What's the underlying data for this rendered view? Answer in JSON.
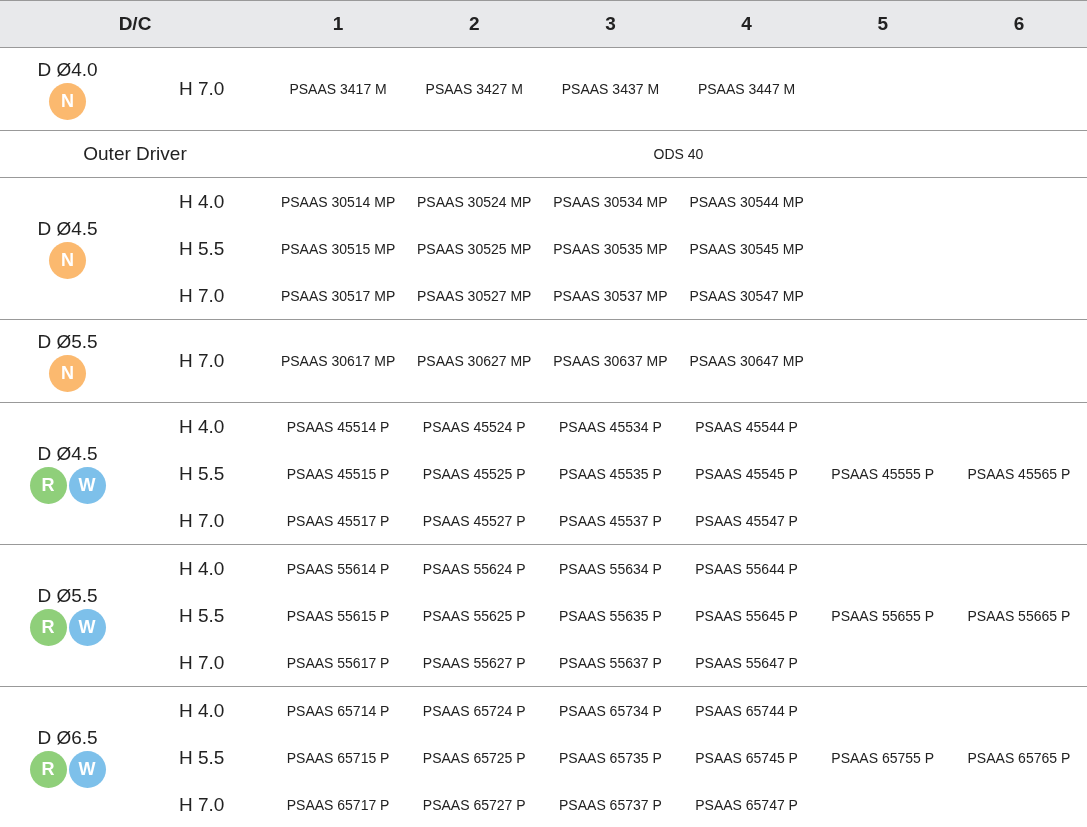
{
  "header": {
    "label": "D/C",
    "columns": [
      "1",
      "2",
      "3",
      "4",
      "5",
      "6"
    ]
  },
  "sections": [
    {
      "kind": "group",
      "diameter": "D Ø4.0",
      "badges": [
        {
          "letter": "N",
          "color": "#fbb96f"
        }
      ],
      "rows": [
        {
          "height": "H 7.0",
          "codes": [
            "PSAAS 3417 M",
            "PSAAS 3427 M",
            "PSAAS 3437 M",
            "PSAAS 3447 M"
          ]
        }
      ]
    },
    {
      "kind": "span",
      "label": "Outer Driver",
      "value": "ODS 40"
    },
    {
      "kind": "group",
      "diameter": "D Ø4.5",
      "badges": [
        {
          "letter": "N",
          "color": "#fbb96f"
        }
      ],
      "rows": [
        {
          "height": "H 4.0",
          "codes": [
            "PSAAS 30514 MP",
            "PSAAS 30524 MP",
            "PSAAS 30534 MP",
            "PSAAS 30544 MP"
          ]
        },
        {
          "height": "H 5.5",
          "codes": [
            "PSAAS 30515 MP",
            "PSAAS 30525 MP",
            "PSAAS 30535 MP",
            "PSAAS 30545 MP"
          ]
        },
        {
          "height": "H 7.0",
          "codes": [
            "PSAAS 30517 MP",
            "PSAAS 30527 MP",
            "PSAAS 30537 MP",
            "PSAAS 30547 MP"
          ]
        }
      ]
    },
    {
      "kind": "group",
      "diameter": "D Ø5.5",
      "badges": [
        {
          "letter": "N",
          "color": "#fbb96f"
        }
      ],
      "rows": [
        {
          "height": "H 7.0",
          "codes": [
            "PSAAS 30617 MP",
            "PSAAS 30627 MP",
            "PSAAS 30637 MP",
            "PSAAS 30647 MP"
          ]
        }
      ]
    },
    {
      "kind": "group",
      "diameter": "D Ø4.5",
      "badges": [
        {
          "letter": "R",
          "color": "#8fcf7a"
        },
        {
          "letter": "W",
          "color": "#7dc0ea"
        }
      ],
      "rows": [
        {
          "height": "H 4.0",
          "codes": [
            "PSAAS 45514 P",
            "PSAAS 45524 P",
            "PSAAS 45534 P",
            "PSAAS 45544 P"
          ]
        },
        {
          "height": "H 5.5",
          "codes": [
            "PSAAS 45515 P",
            "PSAAS 45525 P",
            "PSAAS 45535 P",
            "PSAAS 45545 P",
            "PSAAS 45555 P",
            "PSAAS 45565 P"
          ]
        },
        {
          "height": "H 7.0",
          "codes": [
            "PSAAS 45517 P",
            "PSAAS 45527 P",
            "PSAAS 45537 P",
            "PSAAS 45547 P"
          ]
        }
      ]
    },
    {
      "kind": "group",
      "diameter": "D Ø5.5",
      "badges": [
        {
          "letter": "R",
          "color": "#8fcf7a"
        },
        {
          "letter": "W",
          "color": "#7dc0ea"
        }
      ],
      "rows": [
        {
          "height": "H 4.0",
          "codes": [
            "PSAAS 55614 P",
            "PSAAS 55624 P",
            "PSAAS 55634 P",
            "PSAAS 55644 P"
          ]
        },
        {
          "height": "H 5.5",
          "codes": [
            "PSAAS 55615 P",
            "PSAAS 55625 P",
            "PSAAS 55635 P",
            "PSAAS 55645 P",
            "PSAAS 55655 P",
            "PSAAS 55665 P"
          ]
        },
        {
          "height": "H 7.0",
          "codes": [
            "PSAAS 55617 P",
            "PSAAS 55627 P",
            "PSAAS 55637 P",
            "PSAAS 55647 P"
          ]
        }
      ]
    },
    {
      "kind": "group",
      "diameter": "D Ø6.5",
      "badges": [
        {
          "letter": "R",
          "color": "#8fcf7a"
        },
        {
          "letter": "W",
          "color": "#7dc0ea"
        }
      ],
      "rows": [
        {
          "height": "H 4.0",
          "codes": [
            "PSAAS 65714 P",
            "PSAAS 65724 P",
            "PSAAS 65734 P",
            "PSAAS 65744 P"
          ]
        },
        {
          "height": "H 5.5",
          "codes": [
            "PSAAS 65715 P",
            "PSAAS 65725 P",
            "PSAAS 65735 P",
            "PSAAS 65745 P",
            "PSAAS 65755 P",
            "PSAAS 65765 P"
          ]
        },
        {
          "height": "H 7.0",
          "codes": [
            "PSAAS 65717 P",
            "PSAAS 65727 P",
            "PSAAS 65737 P",
            "PSAAS 65747 P"
          ]
        }
      ]
    }
  ]
}
